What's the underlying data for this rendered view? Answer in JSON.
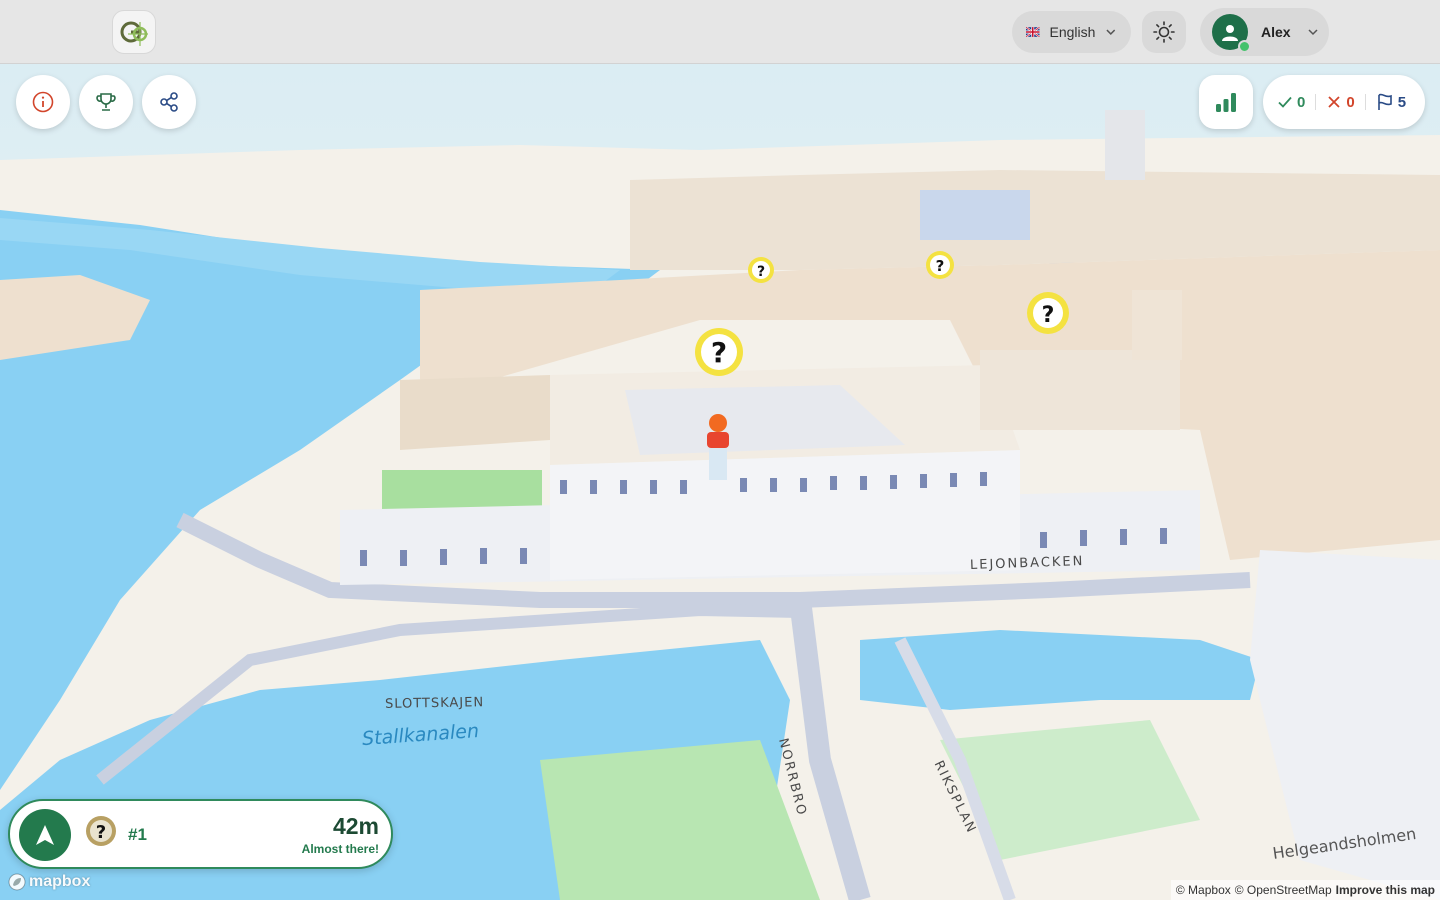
{
  "header": {
    "language_label": "English",
    "user_name": "Alex"
  },
  "toolbar": {
    "info_icon": "info-icon",
    "trophy_icon": "trophy-icon",
    "share_icon": "share-icon",
    "stats_icon": "bar-chart-icon"
  },
  "score": {
    "correct": "0",
    "wrong": "0",
    "flags": "5"
  },
  "map": {
    "labels": [
      "LEJONBACKEN",
      "SLOTTSKAJEN",
      "Stallkanalen",
      "NORRBRO",
      "RIKSPLAN",
      "Helgeandsholmen"
    ],
    "marker_glyph": "?",
    "colors": {
      "water": "#89d0f3",
      "land": "#f7f5f0",
      "road": "#c9d0e0",
      "park": "#b8e6b2",
      "building": "#eee0cf",
      "marker": "#f4e241"
    }
  },
  "target": {
    "number": "#1",
    "distance": "42m",
    "note": "Almost there!"
  },
  "footer": {
    "mapbox_logo": "mapbox",
    "credit_mapbox": "© Mapbox",
    "credit_osm": "© OpenStreetMap",
    "improve": "Improve this map"
  }
}
